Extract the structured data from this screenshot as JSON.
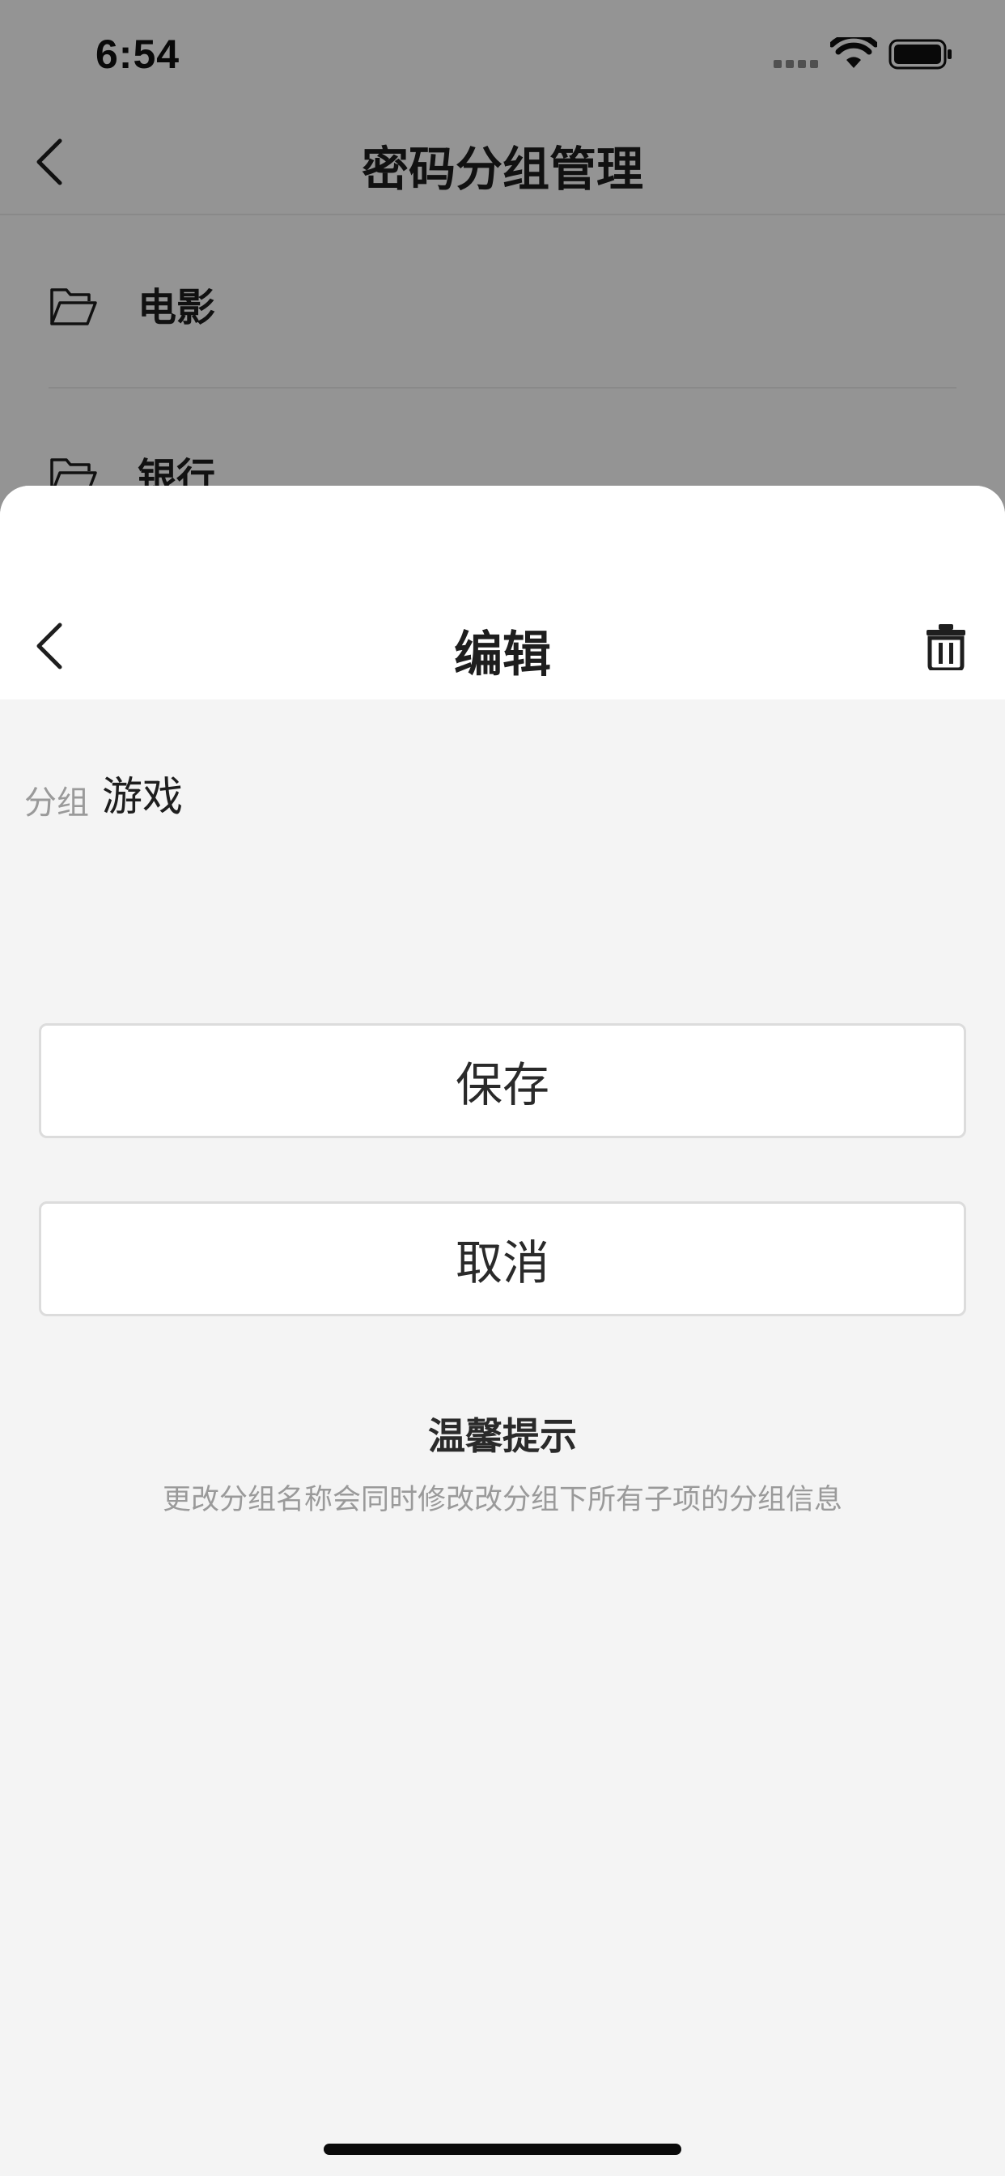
{
  "status_bar": {
    "time": "6:54"
  },
  "background_page": {
    "title": "密码分组管理",
    "items": [
      {
        "label": "电影"
      },
      {
        "label": "银行"
      }
    ]
  },
  "sheet": {
    "title": "编辑",
    "group_label": "分组",
    "group_value": "游戏",
    "save_label": "保存",
    "cancel_label": "取消",
    "tip_title": "温馨提示",
    "tip_text": "更改分组名称会同时修改改分组下所有子项的分组信息"
  },
  "colors": {
    "overlay": "#000000",
    "sheet_bg": "#f4f4f4",
    "text_primary": "#1e1e1e",
    "text_secondary": "#9a9a9a"
  }
}
